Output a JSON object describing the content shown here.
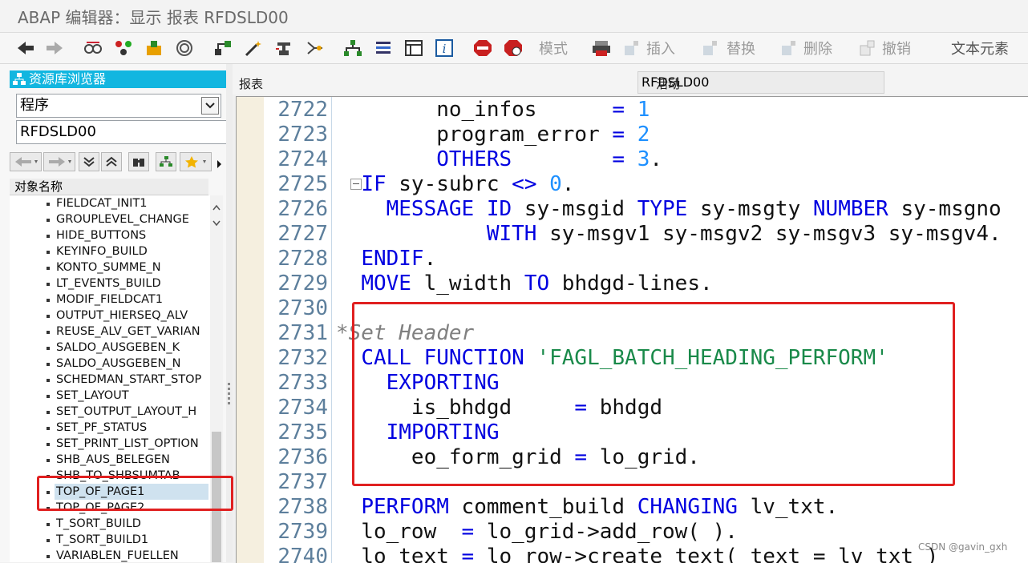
{
  "window": {
    "title": "ABAP 编辑器：显示 报表 RFDSLD00"
  },
  "toolbar": {
    "icons": [
      "back-arrow-icon",
      "forward-arrow-icon",
      "glasses-icon",
      "molecule-icon",
      "object-icon",
      "target-icon",
      "hierarchy-icon",
      "magic-wand-icon",
      "stamp-icon",
      "flow-icon",
      "org-chart-icon",
      "stack-icon",
      "window-icon",
      "info-icon",
      "stop-sign-icon",
      "stop-sign-2-icon"
    ],
    "mode_label": "模式",
    "insert_label": "插入",
    "replace_label": "替换",
    "delete_label": "删除",
    "undo_label": "撤销",
    "text_elements_label": "文本元素"
  },
  "sidebar": {
    "header": "资源库浏览器",
    "object_type": "程序",
    "object_name": "RFDSLD00",
    "column_header": "对象名称",
    "items": [
      "FIELDCAT_INIT1",
      "GROUPLEVEL_CHANGE",
      "HIDE_BUTTONS",
      "KEYINFO_BUILD",
      "KONTO_SUMME_N",
      "LT_EVENTS_BUILD",
      "MODIF_FIELDCAT1",
      "OUTPUT_HIERSEQ_ALV",
      "REUSE_ALV_GET_VARIAN",
      "SALDO_AUSGEBEN_K",
      "SALDO_AUSGEBEN_N",
      "SCHEDMAN_START_STOP",
      "SET_LAYOUT",
      "SET_OUTPUT_LAYOUT_H",
      "SET_PF_STATUS",
      "SET_PRINT_LIST_OPTION",
      "SHB_AUS_BELEGEN",
      "SHB_TO_SHBSUMTAB",
      "TOP_OF_PAGE1",
      "TOP_OF_PAGE2",
      "T_SORT_BUILD",
      "T_SORT_BUILD1",
      "VARIABLEN_FUELLEN"
    ],
    "selected_item": "TOP_OF_PAGE1"
  },
  "editor": {
    "report_label": "报表",
    "report_name": "RFDSLD00",
    "status": "活动",
    "lines": [
      {
        "n": "2722",
        "tokens": [
          [
            "",
            "        no_infos      "
          ],
          [
            "kw",
            "="
          ],
          [
            "",
            " "
          ],
          [
            "num",
            "1"
          ]
        ]
      },
      {
        "n": "2723",
        "tokens": [
          [
            "",
            "        program_error "
          ],
          [
            "kw",
            "="
          ],
          [
            "",
            " "
          ],
          [
            "num",
            "2"
          ]
        ]
      },
      {
        "n": "2724",
        "tokens": [
          [
            "",
            "        "
          ],
          [
            "kw",
            "OTHERS"
          ],
          [
            "",
            "        "
          ],
          [
            "kw",
            "="
          ],
          [
            "",
            " "
          ],
          [
            "num",
            "3"
          ],
          [
            "",
            "."
          ]
        ]
      },
      {
        "n": "2725",
        "tokens": [
          [
            "",
            "  "
          ],
          [
            "kw",
            "IF"
          ],
          [
            "",
            " sy-subrc "
          ],
          [
            "kw",
            "<>"
          ],
          [
            "",
            " "
          ],
          [
            "num",
            "0"
          ],
          [
            "",
            "."
          ]
        ]
      },
      {
        "n": "2726",
        "tokens": [
          [
            "",
            "    "
          ],
          [
            "kw",
            "MESSAGE ID"
          ],
          [
            "",
            " sy-msgid "
          ],
          [
            "kw",
            "TYPE"
          ],
          [
            "",
            " sy-msgty "
          ],
          [
            "kw",
            "NUMBER"
          ],
          [
            "",
            " sy-msgno"
          ]
        ]
      },
      {
        "n": "2727",
        "tokens": [
          [
            "",
            "            "
          ],
          [
            "kw",
            "WITH"
          ],
          [
            "",
            " sy-msgv1 sy-msgv2 sy-msgv3 sy-msgv4."
          ]
        ]
      },
      {
        "n": "2728",
        "tokens": [
          [
            "",
            "  "
          ],
          [
            "kw",
            "ENDIF"
          ],
          [
            "",
            "."
          ]
        ]
      },
      {
        "n": "2729",
        "tokens": [
          [
            "",
            "  "
          ],
          [
            "kw",
            "MOVE"
          ],
          [
            "",
            " l_width "
          ],
          [
            "kw",
            "TO"
          ],
          [
            "",
            " bhdgd-lines."
          ]
        ]
      },
      {
        "n": "2730",
        "tokens": []
      },
      {
        "n": "2731",
        "tokens": [
          [
            "cmt",
            "*Set Header"
          ]
        ]
      },
      {
        "n": "2732",
        "tokens": [
          [
            "",
            "  "
          ],
          [
            "kw",
            "CALL FUNCTION"
          ],
          [
            "",
            " "
          ],
          [
            "str",
            "'FAGL_BATCH_HEADING_PERFORM'"
          ]
        ]
      },
      {
        "n": "2733",
        "tokens": [
          [
            "",
            "    "
          ],
          [
            "kw",
            "EXPORTING"
          ]
        ]
      },
      {
        "n": "2734",
        "tokens": [
          [
            "",
            "      is_bhdgd     "
          ],
          [
            "kw",
            "="
          ],
          [
            "",
            " bhdgd"
          ]
        ]
      },
      {
        "n": "2735",
        "tokens": [
          [
            "",
            "    "
          ],
          [
            "kw",
            "IMPORTING"
          ]
        ]
      },
      {
        "n": "2736",
        "tokens": [
          [
            "",
            "      eo_form_grid "
          ],
          [
            "kw",
            "="
          ],
          [
            "",
            " lo_grid."
          ]
        ]
      },
      {
        "n": "2737",
        "tokens": []
      },
      {
        "n": "2738",
        "tokens": [
          [
            "",
            "  "
          ],
          [
            "kw",
            "PERFORM"
          ],
          [
            "",
            " comment_build "
          ],
          [
            "kw",
            "CHANGING"
          ],
          [
            "",
            " lv_txt."
          ]
        ]
      },
      {
        "n": "2739",
        "tokens": [
          [
            "",
            "  lo_row  "
          ],
          [
            "kw",
            "="
          ],
          [
            "",
            " lo_grid->add_row( )."
          ]
        ]
      },
      {
        "n": "2740",
        "tokens": [
          [
            "",
            "  lo_text "
          ],
          [
            "kw",
            "="
          ],
          [
            "",
            " lo_row->create_text( text = lv_txt )"
          ]
        ]
      }
    ]
  },
  "watermark": "CSDN @gavin_gxh",
  "colors": {
    "accent": "#12b6e0",
    "keyword": "#0000e0",
    "number": "#1e90ff",
    "string": "#1a8a4a",
    "comment": "#808080",
    "highlight": "#e02020"
  }
}
